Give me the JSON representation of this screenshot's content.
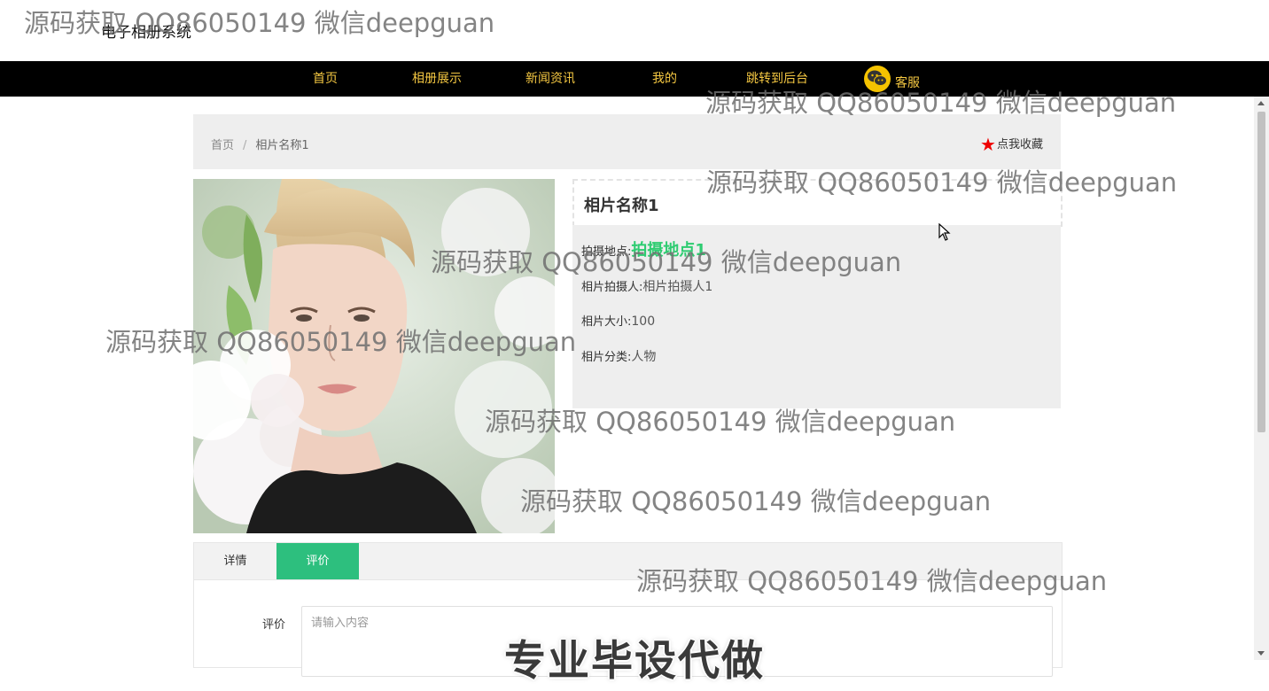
{
  "site": {
    "title": "电子相册系统"
  },
  "nav": {
    "items": [
      {
        "label": "首页"
      },
      {
        "label": "相册展示"
      },
      {
        "label": "新闻资讯"
      },
      {
        "label": "我的"
      },
      {
        "label": "跳转到后台"
      },
      {
        "label": "客服"
      }
    ],
    "kefu_icon": "wechat-icon",
    "bg_color": "#000000",
    "text_color": "#f5c842"
  },
  "breadcrumb": {
    "home": "首页",
    "separator": "/",
    "current": "相片名称1"
  },
  "favorite": {
    "label": "点我收藏",
    "icon": "star-icon"
  },
  "photo": {
    "alt": "相片名称1"
  },
  "detail": {
    "title": "相片名称1",
    "location_label": "拍摄地点:",
    "location_value": "拍摄地点1",
    "photographer_label": "相片拍摄人:",
    "photographer_value": "相片拍摄人1",
    "size_label": "相片大小:",
    "size_value": "100",
    "category_label": "相片分类:",
    "category_value": "人物"
  },
  "tabs": {
    "items": [
      {
        "label": "详情"
      },
      {
        "label": "评价"
      }
    ],
    "active": "评价",
    "accent_color": "#2dbf7e"
  },
  "review": {
    "label": "评价",
    "placeholder": "请输入内容"
  },
  "watermarks": {
    "text": "源码获取 QQ86050149 微信deepguan",
    "banner": "专业毕设代做"
  }
}
